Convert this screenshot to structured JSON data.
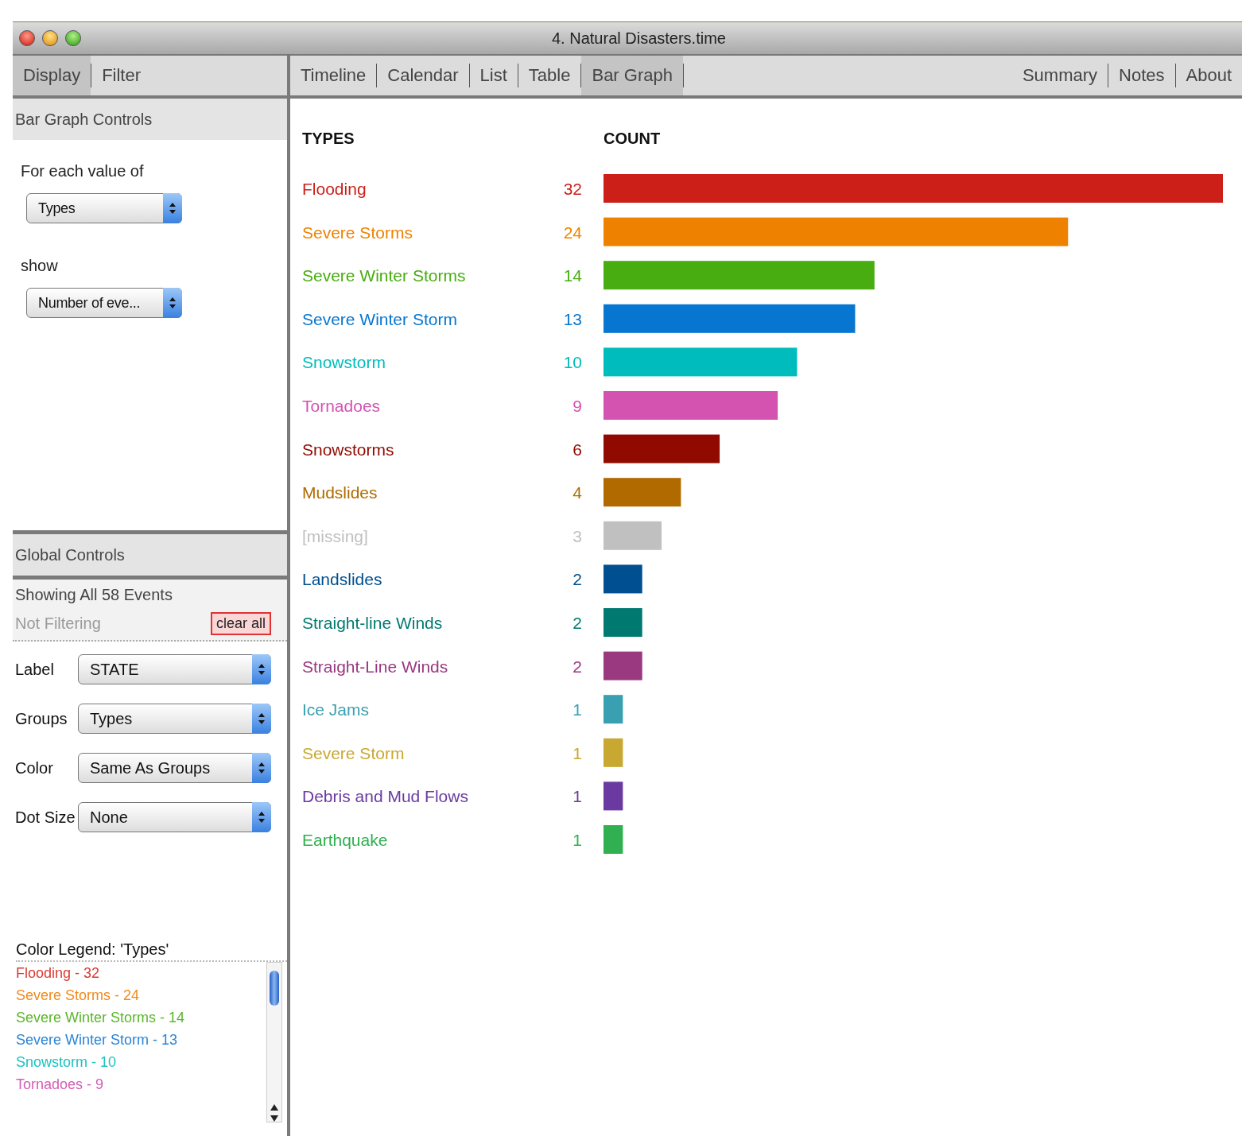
{
  "window": {
    "title": "4. Natural Disasters.time"
  },
  "side_tabs": [
    {
      "label": "Display",
      "selected": true
    },
    {
      "label": "Filter",
      "selected": false
    }
  ],
  "view_tabs": [
    {
      "label": "Timeline",
      "selected": false
    },
    {
      "label": "Calendar",
      "selected": false
    },
    {
      "label": "List",
      "selected": false
    },
    {
      "label": "Table",
      "selected": false
    },
    {
      "label": "Bar Graph",
      "selected": true
    }
  ],
  "info_tabs": [
    {
      "label": "Summary",
      "selected": false
    },
    {
      "label": "Notes",
      "selected": false
    },
    {
      "label": "About",
      "selected": false
    }
  ],
  "bar_graph_controls": {
    "title": "Bar Graph Controls",
    "for_each_label": "For each value of",
    "for_each_value": "Types",
    "show_label": "show",
    "show_value": "Number of eve..."
  },
  "global_controls": {
    "title": "Global Controls",
    "status": "Showing All 58 Events",
    "filter_status": "Not Filtering",
    "clear_button": "clear all",
    "fields": [
      {
        "label": "Label",
        "value": "STATE"
      },
      {
        "label": "Groups",
        "value": "Types"
      },
      {
        "label": "Color",
        "value": "Same As Groups"
      },
      {
        "label": "Dot Size",
        "value": "None"
      }
    ]
  },
  "legend": {
    "title": "Color Legend: 'Types'",
    "items": [
      {
        "text": "Flooding - 32",
        "color": "#d93a32"
      },
      {
        "text": "Severe Storms - 24",
        "color": "#f08a1c"
      },
      {
        "text": "Severe Winter Storms - 14",
        "color": "#5ab52a"
      },
      {
        "text": "Severe Winter Storm - 13",
        "color": "#2a84d6"
      },
      {
        "text": "Snowstorm - 10",
        "color": "#1cc2c2"
      },
      {
        "text": "Tornadoes - 9",
        "color": "#d45cb4"
      }
    ]
  },
  "chart_data": {
    "type": "bar",
    "orientation": "horizontal",
    "ylabel": "TYPES",
    "data_labels": true,
    "categories": [
      "Flooding",
      "Severe Storms",
      "Severe Winter Storms",
      "Severe Winter Storm",
      "Snowstorm",
      "Tornadoes",
      "Snowstorms",
      "Mudslides",
      "[missing]",
      "Landslides",
      "Straight-line Winds",
      "Straight-Line Winds",
      "Ice Jams",
      "Severe Storm",
      "Debris and Mud Flows",
      "Earthquake"
    ],
    "series": [
      {
        "name": "COUNT",
        "values": [
          32,
          24,
          14,
          13,
          10,
          9,
          6,
          4,
          3,
          2,
          2,
          2,
          1,
          1,
          1,
          1
        ]
      }
    ],
    "colors": [
      "#cc1f18",
      "#ee8200",
      "#48ad10",
      "#0676d0",
      "#00bcbc",
      "#d452b0",
      "#900a00",
      "#b06a00",
      "#c0c0c0",
      "#004f90",
      "#007a70",
      "#9a3880",
      "#38a0b0",
      "#c8a830",
      "#6a3aa0",
      "#30b050"
    ]
  }
}
